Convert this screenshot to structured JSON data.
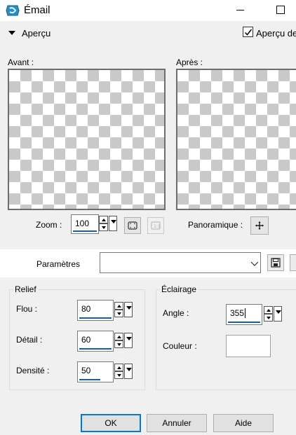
{
  "window": {
    "title": "Émail"
  },
  "preview_section": {
    "toggle_label": "Aperçu",
    "preview_checkbox_label": "Aperçu de",
    "preview_checked": true,
    "before_label": "Avant :",
    "after_label": "Après :"
  },
  "zoom": {
    "label": "Zoom :",
    "value": "100"
  },
  "panoramique": {
    "label": "Panoramique :"
  },
  "parametres": {
    "label": "Paramètres",
    "value": ""
  },
  "relief": {
    "title": "Relief",
    "flou_label": "Flou :",
    "flou_value": "80",
    "detail_label": "Détail :",
    "detail_value": "60",
    "densite_label": "Densité :",
    "densite_value": "50"
  },
  "eclairage": {
    "title": "Éclairage",
    "angle_label": "Angle :",
    "angle_value": "355",
    "couleur_label": "Couleur :",
    "couleur_value": "#ffffff"
  },
  "buttons": {
    "ok": "OK",
    "annuler": "Annuler",
    "aide": "Aide"
  },
  "colors": {
    "accent": "#0078d7",
    "spin_underline": "#0f5fb6",
    "app_icon": "#2a8fc7"
  }
}
